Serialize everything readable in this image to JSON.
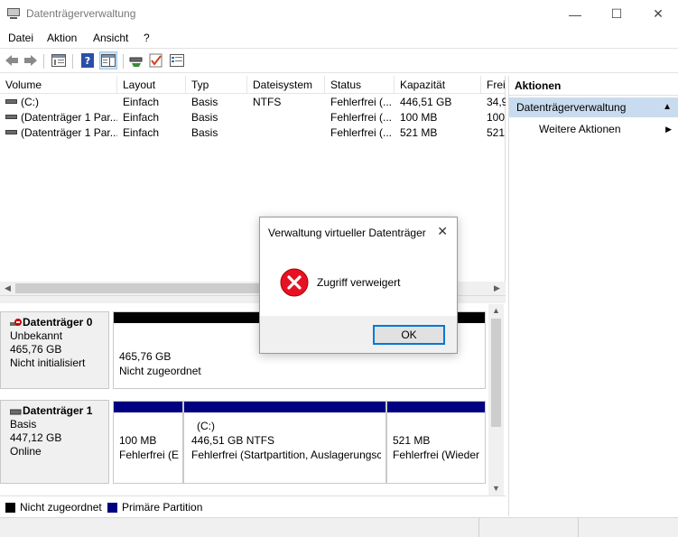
{
  "window": {
    "title": "Datenträgerverwaltung",
    "controls": {
      "minimize": "—",
      "maximize": "☐",
      "close": "✕"
    }
  },
  "menu": [
    "Datei",
    "Aktion",
    "Ansicht",
    "?"
  ],
  "volume_list": {
    "columns": [
      "Volume",
      "Layout",
      "Typ",
      "Dateisystem",
      "Status",
      "Kapazität",
      "Frei"
    ],
    "rows": [
      [
        "(C:)",
        "Einfach",
        "Basis",
        "NTFS",
        "Fehlerfrei (...",
        "446,51 GB",
        "34,9"
      ],
      [
        "(Datenträger 1 Par...",
        "Einfach",
        "Basis",
        "",
        "Fehlerfrei (...",
        "100 MB",
        "100"
      ],
      [
        "(Datenträger 1 Par...",
        "Einfach",
        "Basis",
        "",
        "Fehlerfrei (...",
        "521 MB",
        "521"
      ]
    ]
  },
  "disks": [
    {
      "name": "Datenträger 0",
      "type": "Unbekannt",
      "size": "465,76 GB",
      "state": "Nicht initialisiert",
      "partitions": [
        {
          "line1": "",
          "line2": "465,76 GB",
          "line3": "Nicht zugeordnet",
          "bar_color": "#000000"
        }
      ]
    },
    {
      "name": "Datenträger 1",
      "type": "Basis",
      "size": "447,12 GB",
      "state": "Online",
      "partitions": [
        {
          "line1": "",
          "line2": "100 MB",
          "line3": "Fehlerfrei (E",
          "bar_color": "#000080"
        },
        {
          "line1": "(C:)",
          "line2": "446,51 GB NTFS",
          "line3": "Fehlerfrei (Startpartition, Auslagerungsc",
          "bar_color": "#000080"
        },
        {
          "line1": "",
          "line2": "521 MB",
          "line3": "Fehlerfrei (Wieder",
          "bar_color": "#000080"
        }
      ]
    }
  ],
  "legend": [
    {
      "label": "Nicht zugeordnet",
      "color": "#000000"
    },
    {
      "label": "Primäre Partition",
      "color": "#000080"
    }
  ],
  "actions": {
    "header": "Aktionen",
    "section": "Datenträgerverwaltung",
    "item": "Weitere Aktionen"
  },
  "dialog": {
    "title": "Verwaltung virtueller Datenträger",
    "message": "Zugriff verweigert",
    "ok": "OK",
    "icon": "error-icon"
  }
}
